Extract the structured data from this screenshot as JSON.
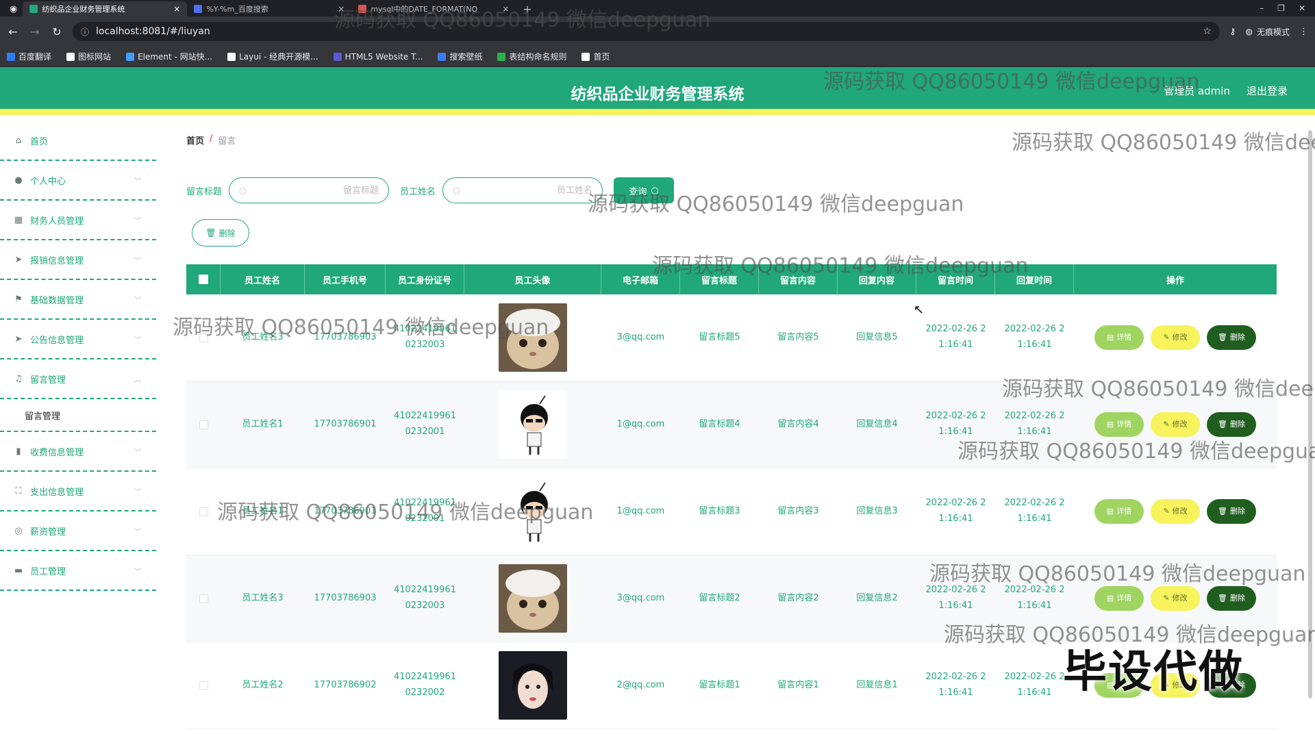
{
  "browser": {
    "tabs": [
      {
        "title": "纺织品企业财务管理系统",
        "active": true,
        "color": "#20a77a"
      },
      {
        "title": "%Y-%m_百度搜索",
        "active": false,
        "color": "#4e6ef2"
      },
      {
        "title": "mysql中的DATE_FORMAT(NO",
        "active": false,
        "color": "#d9534f"
      }
    ],
    "url": "localhost:8081/#/liuyan",
    "incognito": "无痕模式",
    "bookmarks": [
      {
        "label": "百度翻译",
        "color": "#2d7cf6"
      },
      {
        "label": "图标网站",
        "color": "#ffffff"
      },
      {
        "label": "Element - 网站快...",
        "color": "#409eff"
      },
      {
        "label": "Layui - 经典开源模...",
        "color": "#ffffff"
      },
      {
        "label": "HTML5 Website T...",
        "color": "#5b5bd6"
      },
      {
        "label": "搜索壁纸",
        "color": "#3b7cf0"
      },
      {
        "label": "表结构命名规则",
        "color": "#2bb24c"
      },
      {
        "label": "首页",
        "color": "#ffffff"
      }
    ]
  },
  "header": {
    "title": "纺织品企业财务管理系统",
    "user": "管理员 admin",
    "logout": "退出登录"
  },
  "sidebar": {
    "items": [
      {
        "label": "首页",
        "icon": "home-icon",
        "glyph": "⌂",
        "arrow": false
      },
      {
        "label": "个人中心",
        "icon": "user-icon",
        "glyph": "●",
        "arrow": true
      },
      {
        "label": "财务人员管理",
        "icon": "grid-icon",
        "glyph": "▦",
        "arrow": true
      },
      {
        "label": "报销信息管理",
        "icon": "send-icon",
        "glyph": "➤",
        "arrow": true
      },
      {
        "label": "基础数据管理",
        "icon": "flag-icon",
        "glyph": "⚑",
        "arrow": true
      },
      {
        "label": "公告信息管理",
        "icon": "send-icon",
        "glyph": "➤",
        "arrow": true
      },
      {
        "label": "留言管理",
        "icon": "mic-icon",
        "glyph": "♫",
        "arrow": true,
        "expanded": true
      }
    ],
    "sub_item": "留言管理",
    "items_after": [
      {
        "label": "收费信息管理",
        "icon": "chart-icon",
        "glyph": "▮",
        "arrow": true
      },
      {
        "label": "支出信息管理",
        "icon": "scan-icon",
        "glyph": "⛶",
        "arrow": true
      },
      {
        "label": "薪资管理",
        "icon": "circle-icon",
        "glyph": "◎",
        "arrow": true
      },
      {
        "label": "员工管理",
        "icon": "monitor-icon",
        "glyph": "▬",
        "arrow": true
      }
    ]
  },
  "breadcrumb": {
    "home": "首页",
    "sep": "/",
    "current": "留言"
  },
  "search": {
    "title_label": "留言标题",
    "title_placeholder": "留言标题",
    "name_label": "员工姓名",
    "name_placeholder": "员工姓名",
    "query_button": "查询"
  },
  "delete_button": "删除",
  "table": {
    "headers": [
      "",
      "员工姓名",
      "员工手机号",
      "员工身份证号",
      "员工头像",
      "电子邮箱",
      "留言标题",
      "留言内容",
      "回复内容",
      "留言时间",
      "回复时间",
      "操作"
    ],
    "rows": [
      {
        "name": "员工姓名3",
        "phone": "17703786903",
        "id1": "41022419961",
        "id2": "0232003",
        "avatar": "cat",
        "email": "3@qq.com",
        "title": "留言标题5",
        "content": "留言内容5",
        "reply": "回复信息5",
        "t1": "2022-02-26 2",
        "t2": "1:16:41",
        "r1": "2022-02-26 2",
        "r2": "1:16:41"
      },
      {
        "name": "员工姓名1",
        "phone": "17703786901",
        "id1": "41022419961",
        "id2": "0232001",
        "avatar": "cartoon",
        "email": "1@qq.com",
        "title": "留言标题4",
        "content": "留言内容4",
        "reply": "回复信息4",
        "t1": "2022-02-26 2",
        "t2": "1:16:41",
        "r1": "2022-02-26 2",
        "r2": "1:16:41"
      },
      {
        "name": "员工姓名1",
        "phone": "17703786901",
        "id1": "41022419961",
        "id2": "0232001",
        "avatar": "cartoon",
        "email": "1@qq.com",
        "title": "留言标题3",
        "content": "留言内容3",
        "reply": "回复信息3",
        "t1": "2022-02-26 2",
        "t2": "1:16:41",
        "r1": "2022-02-26 2",
        "r2": "1:16:41"
      },
      {
        "name": "员工姓名3",
        "phone": "17703786903",
        "id1": "41022419961",
        "id2": "0232003",
        "avatar": "cat",
        "email": "3@qq.com",
        "title": "留言标题2",
        "content": "留言内容2",
        "reply": "回复信息2",
        "t1": "2022-02-26 2",
        "t2": "1:16:41",
        "r1": "2022-02-26 2",
        "r2": "1:16:41"
      },
      {
        "name": "员工姓名2",
        "phone": "17703786902",
        "id1": "41022419961",
        "id2": "0232002",
        "avatar": "girl",
        "email": "2@qq.com",
        "title": "留言标题1",
        "content": "留言内容1",
        "reply": "回复信息1",
        "t1": "2022-02-26 2",
        "t2": "1:16:41",
        "r1": "2022-02-26 2",
        "r2": "1:16:41"
      }
    ],
    "actions": {
      "detail": "详情",
      "edit": "修改",
      "delete": "删除"
    }
  },
  "watermark": {
    "text": "源码获取 QQ86050149 微信deepguan",
    "stamp": "毕设代做"
  },
  "colors": {
    "primary": "#20a77a",
    "accent": "#f6f35c",
    "dark": "#1f5e1f",
    "light": "#9fd461"
  }
}
